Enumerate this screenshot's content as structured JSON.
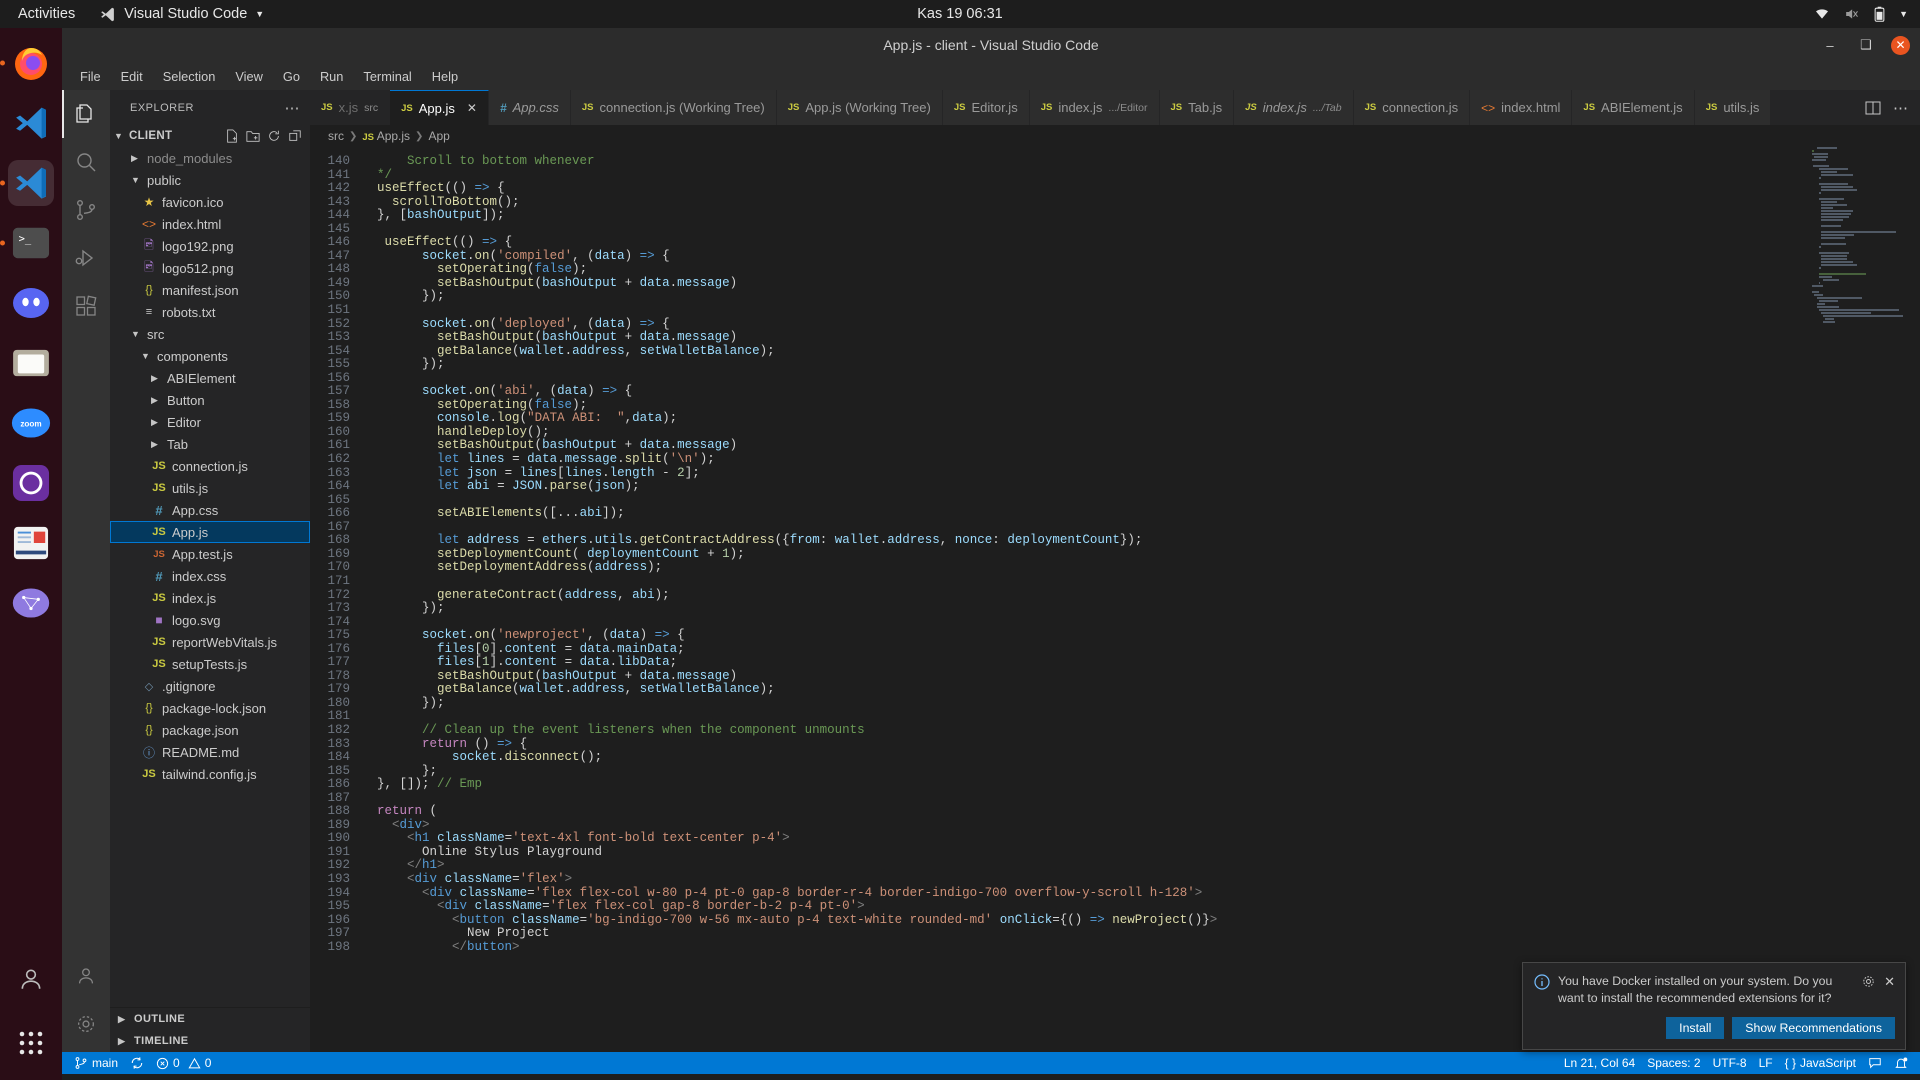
{
  "gnome": {
    "activities": "Activities",
    "app_name": "Visual Studio Code",
    "clock": "Kas 19  06:31",
    "tray": [
      "wifi-icon",
      "volume-muted-icon",
      "battery-icon",
      "chevron-down-icon"
    ]
  },
  "dock": [
    {
      "name": "firefox",
      "running": true
    },
    {
      "name": "vscode",
      "running": false
    },
    {
      "name": "vscode-window",
      "running": true,
      "active": true
    },
    {
      "name": "terminal",
      "running": true
    },
    {
      "name": "discord",
      "running": false
    },
    {
      "name": "files",
      "running": false
    },
    {
      "name": "zoom",
      "running": false
    },
    {
      "name": "github-desktop",
      "running": false
    },
    {
      "name": "news-reader",
      "running": false
    },
    {
      "name": "network-app",
      "running": false
    }
  ],
  "window": {
    "title": "App.js - client - Visual Studio Code",
    "minimize": "–",
    "maximize": "❑",
    "close": "✕"
  },
  "menubar": [
    "File",
    "Edit",
    "Selection",
    "View",
    "Go",
    "Run",
    "Terminal",
    "Help"
  ],
  "activitybar": [
    {
      "name": "explorer",
      "active": true
    },
    {
      "name": "search",
      "active": false
    },
    {
      "name": "source-control",
      "active": false
    },
    {
      "name": "run-and-debug",
      "active": false
    },
    {
      "name": "extensions",
      "active": false
    }
  ],
  "sidebar": {
    "title": "EXPLORER",
    "more": "⋯",
    "folder": "CLIENT",
    "actions": [
      "new-file-icon",
      "new-folder-icon",
      "refresh-icon",
      "collapse-all-icon"
    ],
    "tree": [
      {
        "label": "node_modules",
        "indent": 1,
        "type": "folder",
        "expanded": false,
        "dim": true
      },
      {
        "label": "public",
        "indent": 1,
        "type": "folder",
        "expanded": true
      },
      {
        "label": "favicon.ico",
        "indent": 2,
        "type": "ico"
      },
      {
        "label": "index.html",
        "indent": 2,
        "type": "html"
      },
      {
        "label": "logo192.png",
        "indent": 2,
        "type": "png"
      },
      {
        "label": "logo512.png",
        "indent": 2,
        "type": "png"
      },
      {
        "label": "manifest.json",
        "indent": 2,
        "type": "json"
      },
      {
        "label": "robots.txt",
        "indent": 2,
        "type": "txt"
      },
      {
        "label": "src",
        "indent": 1,
        "type": "folder",
        "expanded": true
      },
      {
        "label": "components",
        "indent": 2,
        "type": "folder",
        "expanded": true
      },
      {
        "label": "ABIElement",
        "indent": 3,
        "type": "folder",
        "expanded": false
      },
      {
        "label": "Button",
        "indent": 3,
        "type": "folder",
        "expanded": false
      },
      {
        "label": "Editor",
        "indent": 3,
        "type": "folder",
        "expanded": false
      },
      {
        "label": "Tab",
        "indent": 3,
        "type": "folder",
        "expanded": false
      },
      {
        "label": "connection.js",
        "indent": 3,
        "type": "js"
      },
      {
        "label": "utils.js",
        "indent": 3,
        "type": "js"
      },
      {
        "label": "App.css",
        "indent": 3,
        "type": "css"
      },
      {
        "label": "App.js",
        "indent": 3,
        "type": "js",
        "selected": true
      },
      {
        "label": "App.test.js",
        "indent": 3,
        "type": "test"
      },
      {
        "label": "index.css",
        "indent": 3,
        "type": "css"
      },
      {
        "label": "index.js",
        "indent": 3,
        "type": "js"
      },
      {
        "label": "logo.svg",
        "indent": 3,
        "type": "svg"
      },
      {
        "label": "reportWebVitals.js",
        "indent": 3,
        "type": "js"
      },
      {
        "label": "setupTests.js",
        "indent": 3,
        "type": "js"
      },
      {
        "label": ".gitignore",
        "indent": 2,
        "type": "git"
      },
      {
        "label": "package-lock.json",
        "indent": 2,
        "type": "json"
      },
      {
        "label": "package.json",
        "indent": 2,
        "type": "json"
      },
      {
        "label": "README.md",
        "indent": 2,
        "type": "md"
      },
      {
        "label": "tailwind.config.js",
        "indent": 2,
        "type": "js"
      }
    ],
    "panels": [
      "OUTLINE",
      "TIMELINE"
    ]
  },
  "tabs": [
    {
      "label": "x.js",
      "suffix": "src",
      "type": "js",
      "active": false,
      "partial": true
    },
    {
      "label": "App.js",
      "type": "js",
      "active": true,
      "close": "✕"
    },
    {
      "label": "App.css",
      "type": "css",
      "active": false,
      "italic": true
    },
    {
      "label": "connection.js (Working Tree)",
      "type": "js",
      "active": false
    },
    {
      "label": "App.js (Working Tree)",
      "type": "js",
      "active": false
    },
    {
      "label": "Editor.js",
      "type": "js",
      "active": false
    },
    {
      "label": "index.js",
      "suffix": ".../Editor",
      "type": "js",
      "active": false
    },
    {
      "label": "Tab.js",
      "type": "js",
      "active": false
    },
    {
      "label": "index.js",
      "suffix": ".../Tab",
      "type": "js",
      "active": false,
      "italic": true
    },
    {
      "label": "connection.js",
      "type": "js",
      "active": false
    },
    {
      "label": "index.html",
      "type": "html",
      "active": false
    },
    {
      "label": "ABIElement.js",
      "type": "js",
      "active": false
    },
    {
      "label": "utils.js",
      "type": "js",
      "active": false
    }
  ],
  "tabbar_actions": [
    "split-editor-icon",
    "more-actions-icon"
  ],
  "breadcrumb": [
    "src",
    "App.js",
    "App"
  ],
  "code": {
    "first_line": 140,
    "lines": [
      {
        "n": 140,
        "html": "    <span class='t-cmt'>  Scroll to bottom whenever</span>"
      },
      {
        "n": 141,
        "html": "  <span class='t-cmt'>*/</span>"
      },
      {
        "n": 142,
        "html": "  <span class='t-fn'>useEffect</span><span class='t-plain'>(() </span><span class='t-kw'>=&gt;</span><span class='t-plain'> {</span>"
      },
      {
        "n": 143,
        "html": "    <span class='t-fn'>scrollToBottom</span><span class='t-plain'>();</span>"
      },
      {
        "n": 144,
        "html": "  <span class='t-plain'>}, [</span><span class='t-var'>bashOutput</span><span class='t-plain'>]);</span>"
      },
      {
        "n": 145,
        "html": ""
      },
      {
        "n": 146,
        "html": "   <span class='t-fn'>useEffect</span><span class='t-plain'>(() </span><span class='t-kw'>=&gt;</span><span class='t-plain'> {</span>"
      },
      {
        "n": 147,
        "html": "        <span class='t-var'>socket</span><span class='t-plain'>.</span><span class='t-fn'>on</span><span class='t-plain'>(</span><span class='t-str'>'compiled'</span><span class='t-plain'>, (</span><span class='t-var'>data</span><span class='t-plain'>) </span><span class='t-kw'>=&gt;</span><span class='t-plain'> {</span>"
      },
      {
        "n": 148,
        "html": "          <span class='t-fn'>setOperating</span><span class='t-plain'>(</span><span class='t-kw'>false</span><span class='t-plain'>);</span>"
      },
      {
        "n": 149,
        "html": "          <span class='t-fn'>setBashOutput</span><span class='t-plain'>(</span><span class='t-var'>bashOutput</span><span class='t-plain'> + </span><span class='t-var'>data</span><span class='t-plain'>.</span><span class='t-var'>message</span><span class='t-plain'>)</span>"
      },
      {
        "n": 150,
        "html": "        <span class='t-plain'>});</span>"
      },
      {
        "n": 151,
        "html": ""
      },
      {
        "n": 152,
        "html": "        <span class='t-var'>socket</span><span class='t-plain'>.</span><span class='t-fn'>on</span><span class='t-plain'>(</span><span class='t-str'>'deployed'</span><span class='t-plain'>, (</span><span class='t-var'>data</span><span class='t-plain'>) </span><span class='t-kw'>=&gt;</span><span class='t-plain'> {</span>"
      },
      {
        "n": 153,
        "html": "          <span class='t-fn'>setBashOutput</span><span class='t-plain'>(</span><span class='t-var'>bashOutput</span><span class='t-plain'> + </span><span class='t-var'>data</span><span class='t-plain'>.</span><span class='t-var'>message</span><span class='t-plain'>)</span>"
      },
      {
        "n": 154,
        "html": "          <span class='t-fn'>getBalance</span><span class='t-plain'>(</span><span class='t-var'>wallet</span><span class='t-plain'>.</span><span class='t-var'>address</span><span class='t-plain'>, </span><span class='t-var'>setWalletBalance</span><span class='t-plain'>);</span>"
      },
      {
        "n": 155,
        "html": "        <span class='t-plain'>});</span>"
      },
      {
        "n": 156,
        "html": ""
      },
      {
        "n": 157,
        "html": "        <span class='t-var'>socket</span><span class='t-plain'>.</span><span class='t-fn'>on</span><span class='t-plain'>(</span><span class='t-str'>'abi'</span><span class='t-plain'>, (</span><span class='t-var'>data</span><span class='t-plain'>) </span><span class='t-kw'>=&gt;</span><span class='t-plain'> {</span>"
      },
      {
        "n": 158,
        "html": "          <span class='t-fn'>setOperating</span><span class='t-plain'>(</span><span class='t-kw'>false</span><span class='t-plain'>);</span>"
      },
      {
        "n": 159,
        "html": "          <span class='t-var'>console</span><span class='t-plain'>.</span><span class='t-fn'>log</span><span class='t-plain'>(</span><span class='t-str'>\"DATA ABI:  \"</span><span class='t-plain'>,</span><span class='t-var'>data</span><span class='t-plain'>);</span>"
      },
      {
        "n": 160,
        "html": "          <span class='t-fn'>handleDeploy</span><span class='t-plain'>();</span>"
      },
      {
        "n": 161,
        "html": "          <span class='t-fn'>setBashOutput</span><span class='t-plain'>(</span><span class='t-var'>bashOutput</span><span class='t-plain'> + </span><span class='t-var'>data</span><span class='t-plain'>.</span><span class='t-var'>message</span><span class='t-plain'>)</span>"
      },
      {
        "n": 162,
        "html": "          <span class='t-kw'>let</span><span class='t-plain'> </span><span class='t-var'>lines</span><span class='t-plain'> = </span><span class='t-var'>data</span><span class='t-plain'>.</span><span class='t-var'>message</span><span class='t-plain'>.</span><span class='t-fn'>split</span><span class='t-plain'>(</span><span class='t-str'>'\\n'</span><span class='t-plain'>);</span>"
      },
      {
        "n": 163,
        "html": "          <span class='t-kw'>let</span><span class='t-plain'> </span><span class='t-var'>json</span><span class='t-plain'> = </span><span class='t-var'>lines</span><span class='t-plain'>[</span><span class='t-var'>lines</span><span class='t-plain'>.</span><span class='t-var'>length</span><span class='t-plain'> - </span><span class='t-num'>2</span><span class='t-plain'>];</span>"
      },
      {
        "n": 164,
        "html": "          <span class='t-kw'>let</span><span class='t-plain'> </span><span class='t-var'>abi</span><span class='t-plain'> = </span><span class='t-var'>JSON</span><span class='t-plain'>.</span><span class='t-fn'>parse</span><span class='t-plain'>(</span><span class='t-var'>json</span><span class='t-plain'>);</span>"
      },
      {
        "n": 165,
        "html": ""
      },
      {
        "n": 166,
        "html": "          <span class='t-fn'>setABIElements</span><span class='t-plain'>([...</span><span class='t-var'>abi</span><span class='t-plain'>]);</span>"
      },
      {
        "n": 167,
        "html": ""
      },
      {
        "n": 168,
        "html": "          <span class='t-kw'>let</span><span class='t-plain'> </span><span class='t-var'>address</span><span class='t-plain'> = </span><span class='t-var'>ethers</span><span class='t-plain'>.</span><span class='t-var'>utils</span><span class='t-plain'>.</span><span class='t-fn'>getContractAddress</span><span class='t-plain'>({</span><span class='t-var'>from</span><span class='t-plain'>: </span><span class='t-var'>wallet</span><span class='t-plain'>.</span><span class='t-var'>address</span><span class='t-plain'>, </span><span class='t-var'>nonce</span><span class='t-plain'>: </span><span class='t-var'>deploymentCount</span><span class='t-plain'>});</span>"
      },
      {
        "n": 169,
        "html": "          <span class='t-fn'>setDeploymentCount</span><span class='t-plain'>( </span><span class='t-var'>deploymentCount</span><span class='t-plain'> + </span><span class='t-num'>1</span><span class='t-plain'>);</span>"
      },
      {
        "n": 170,
        "html": "          <span class='t-fn'>setDeploymentAddress</span><span class='t-plain'>(</span><span class='t-var'>address</span><span class='t-plain'>);</span>"
      },
      {
        "n": 171,
        "html": ""
      },
      {
        "n": 172,
        "html": "          <span class='t-fn'>generateContract</span><span class='t-plain'>(</span><span class='t-var'>address</span><span class='t-plain'>, </span><span class='t-var'>abi</span><span class='t-plain'>);</span>"
      },
      {
        "n": 173,
        "html": "        <span class='t-plain'>});</span>"
      },
      {
        "n": 174,
        "html": ""
      },
      {
        "n": 175,
        "html": "        <span class='t-var'>socket</span><span class='t-plain'>.</span><span class='t-fn'>on</span><span class='t-plain'>(</span><span class='t-str'>'newproject'</span><span class='t-plain'>, (</span><span class='t-var'>data</span><span class='t-plain'>) </span><span class='t-kw'>=&gt;</span><span class='t-plain'> {</span>"
      },
      {
        "n": 176,
        "html": "          <span class='t-var'>files</span><span class='t-plain'>[</span><span class='t-num'>0</span><span class='t-plain'>].</span><span class='t-var'>content</span><span class='t-plain'> = </span><span class='t-var'>data</span><span class='t-plain'>.</span><span class='t-var'>mainData</span><span class='t-plain'>;</span>"
      },
      {
        "n": 177,
        "html": "          <span class='t-var'>files</span><span class='t-plain'>[</span><span class='t-num'>1</span><span class='t-plain'>].</span><span class='t-var'>content</span><span class='t-plain'> = </span><span class='t-var'>data</span><span class='t-plain'>.</span><span class='t-var'>libData</span><span class='t-plain'>;</span>"
      },
      {
        "n": 178,
        "html": "          <span class='t-fn'>setBashOutput</span><span class='t-plain'>(</span><span class='t-var'>bashOutput</span><span class='t-plain'> + </span><span class='t-var'>data</span><span class='t-plain'>.</span><span class='t-var'>message</span><span class='t-plain'>)</span>"
      },
      {
        "n": 179,
        "html": "          <span class='t-fn'>getBalance</span><span class='t-plain'>(</span><span class='t-var'>wallet</span><span class='t-plain'>.</span><span class='t-var'>address</span><span class='t-plain'>, </span><span class='t-var'>setWalletBalance</span><span class='t-plain'>);</span>"
      },
      {
        "n": 180,
        "html": "        <span class='t-plain'>});</span>"
      },
      {
        "n": 181,
        "html": ""
      },
      {
        "n": 182,
        "html": "        <span class='t-cmt'>// Clean up the event listeners when the component unmounts</span>"
      },
      {
        "n": 183,
        "html": "        <span class='t-key'>return</span><span class='t-plain'> () </span><span class='t-kw'>=&gt;</span><span class='t-plain'> {</span>"
      },
      {
        "n": 184,
        "html": "            <span class='t-var'>socket</span><span class='t-plain'>.</span><span class='t-fn'>disconnect</span><span class='t-plain'>();</span>"
      },
      {
        "n": 185,
        "html": "        <span class='t-plain'>};</span>"
      },
      {
        "n": 186,
        "html": "  <span class='t-plain'>}, []); </span><span class='t-cmt'>// Emp</span>"
      },
      {
        "n": 187,
        "html": ""
      },
      {
        "n": 188,
        "html": "  <span class='t-key'>return</span><span class='t-plain'> (</span>"
      },
      {
        "n": 189,
        "html": "    <span class='t-tag'>&lt;</span><span class='t-jsxtag'>div</span><span class='t-tag'>&gt;</span>"
      },
      {
        "n": 190,
        "html": "      <span class='t-tag'>&lt;</span><span class='t-jsxtag'>h1</span><span class='t-plain'> </span><span class='t-attr'>className</span><span class='t-plain'>=</span><span class='t-str'>'text-4xl font-bold text-center p-4'</span><span class='t-tag'>&gt;</span>"
      },
      {
        "n": 191,
        "html": "        <span class='t-plain'>Online Stylus Playground</span>"
      },
      {
        "n": 192,
        "html": "      <span class='t-tag'>&lt;/</span><span class='t-jsxtag'>h1</span><span class='t-tag'>&gt;</span>"
      },
      {
        "n": 193,
        "html": "      <span class='t-tag'>&lt;</span><span class='t-jsxtag'>div</span><span class='t-plain'> </span><span class='t-attr'>className</span><span class='t-plain'>=</span><span class='t-str'>'flex'</span><span class='t-tag'>&gt;</span>"
      },
      {
        "n": 194,
        "html": "        <span class='t-tag'>&lt;</span><span class='t-jsxtag'>div</span><span class='t-plain'> </span><span class='t-attr'>className</span><span class='t-plain'>=</span><span class='t-str'>'flex flex-col w-80 p-4 pt-0 gap-8 border-r-4 border-indigo-700 overflow-y-scroll h-128'</span><span class='t-tag'>&gt;</span>"
      },
      {
        "n": 195,
        "html": "          <span class='t-tag'>&lt;</span><span class='t-jsxtag'>div</span><span class='t-plain'> </span><span class='t-attr'>className</span><span class='t-plain'>=</span><span class='t-str'>'flex flex-col gap-8 border-b-2 p-4 pt-0'</span><span class='t-tag'>&gt;</span>"
      },
      {
        "n": 196,
        "html": "            <span class='t-tag'>&lt;</span><span class='t-jsxtag'>button</span><span class='t-plain'> </span><span class='t-attr'>className</span><span class='t-plain'>=</span><span class='t-str'>'bg-indigo-700 w-56 mx-auto p-4 text-white rounded-md'</span><span class='t-plain'> </span><span class='t-attr'>onClick</span><span class='t-plain'>={() </span><span class='t-kw'>=&gt;</span><span class='t-plain'> </span><span class='t-fn'>newProject</span><span class='t-plain'>()}</span><span class='t-tag'>&gt;</span>"
      },
      {
        "n": 197,
        "html": "              <span class='t-plain'>New Project</span>"
      },
      {
        "n": 198,
        "html": "            <span class='t-tag'>&lt;/</span><span class='t-jsxtag'>button</span><span class='t-tag'>&gt;</span>"
      }
    ]
  },
  "notification": {
    "icon": "info-icon",
    "message": "You have Docker installed on your system. Do you want to install the recommended extensions for it?",
    "gear": "gear-icon",
    "close": "✕",
    "buttons": [
      "Install",
      "Show Recommendations"
    ]
  },
  "statusbar": {
    "branch": "main",
    "sync": "sync-icon",
    "errors": "0",
    "warnings": "0",
    "position": "Ln 21, Col 64",
    "spaces": "Spaces: 2",
    "encoding": "UTF-8",
    "eol": "LF",
    "language": "JavaScript",
    "feedback": "feedback-icon",
    "bell": "bell-icon"
  },
  "colors": {
    "accent": "#0078d4",
    "ubuntu_orange": "#e95420",
    "sidebar_bg": "#252526",
    "editor_bg": "#1e1e1e"
  }
}
